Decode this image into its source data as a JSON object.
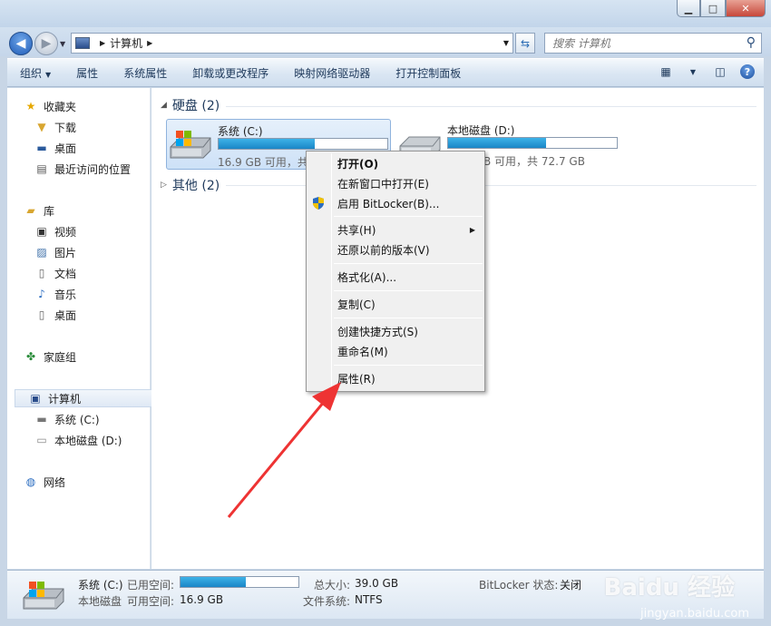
{
  "window": {
    "minimize": "▁",
    "maximize": "□",
    "close": "✕"
  },
  "address": {
    "crumb": "计算机",
    "search_placeholder": "搜索 计算机"
  },
  "toolbar": {
    "organize": "组织",
    "properties": "属性",
    "system_properties": "系统属性",
    "uninstall": "卸载或更改程序",
    "map_drive": "映射网络驱动器",
    "control_panel": "打开控制面板"
  },
  "sidebar": {
    "favorites": "收藏夹",
    "downloads": "下载",
    "desktop": "桌面",
    "recent": "最近访问的位置",
    "libraries": "库",
    "videos": "视频",
    "pictures": "图片",
    "documents": "文档",
    "music": "音乐",
    "lib_desktop": "桌面",
    "homegroup": "家庭组",
    "computer": "计算机",
    "drive_c": "系统 (C:)",
    "drive_d": "本地磁盘 (D:)",
    "network": "网络"
  },
  "content": {
    "group_hdd": "硬盘 (2)",
    "group_other": "其他 (2)",
    "drives": [
      {
        "name": "系统 (C:)",
        "free_text": "16.9 GB 可用，共",
        "used_fraction": 0.57
      },
      {
        "name": "本地磁盘 (D:)",
        "free_text": "B 可用，共 72.7 GB",
        "used_fraction": 0.58
      }
    ]
  },
  "context_menu": {
    "open": "打开(O)",
    "open_new": "在新窗口中打开(E)",
    "bitlocker": "启用 BitLocker(B)...",
    "share": "共享(H)",
    "restore": "还原以前的版本(V)",
    "format": "格式化(A)...",
    "copy": "复制(C)",
    "shortcut": "创建快捷方式(S)",
    "rename": "重命名(M)",
    "properties": "属性(R)"
  },
  "details": {
    "name": "系统 (C:)",
    "type": "本地磁盘",
    "used_label": "已用空间:",
    "used_fraction": 0.55,
    "free_label": "可用空间:",
    "free_value": "16.9 GB",
    "total_label": "总大小:",
    "total_value": "39.0 GB",
    "fs_label": "文件系统:",
    "fs_value": "NTFS",
    "bitlocker_label": "BitLocker 状态:",
    "bitlocker_value": "关闭"
  },
  "watermark": {
    "brand": "Baidu 经验",
    "url": "jingyan.baidu.com"
  }
}
